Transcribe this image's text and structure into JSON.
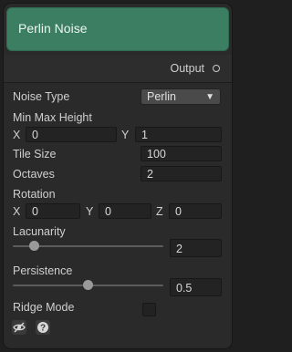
{
  "node": {
    "title": "Perlin Noise",
    "output_label": "Output"
  },
  "fields": {
    "noise_type_label": "Noise Type",
    "noise_type_value": "Perlin",
    "min_max_label": "Min Max Height",
    "min_x_label": "X",
    "min_x_value": "0",
    "max_y_label": "Y",
    "max_y_value": "1",
    "tile_size_label": "Tile Size",
    "tile_size_value": "100",
    "octaves_label": "Octaves",
    "octaves_value": "2",
    "rotation_label": "Rotation",
    "rot_x_label": "X",
    "rot_x_value": "0",
    "rot_y_label": "Y",
    "rot_y_value": "0",
    "rot_z_label": "Z",
    "rot_z_value": "0",
    "lacunarity_label": "Lacunarity",
    "lacunarity_value": "2",
    "persistence_label": "Persistence",
    "persistence_value": "0.5",
    "ridge_mode_label": "Ridge Mode",
    "ridge_mode_checked": false
  },
  "sliders": {
    "lacunarity_fraction": 0.14,
    "persistence_fraction": 0.5
  },
  "icons": {
    "visibility": "eye-slash-icon",
    "help": "question-icon"
  }
}
